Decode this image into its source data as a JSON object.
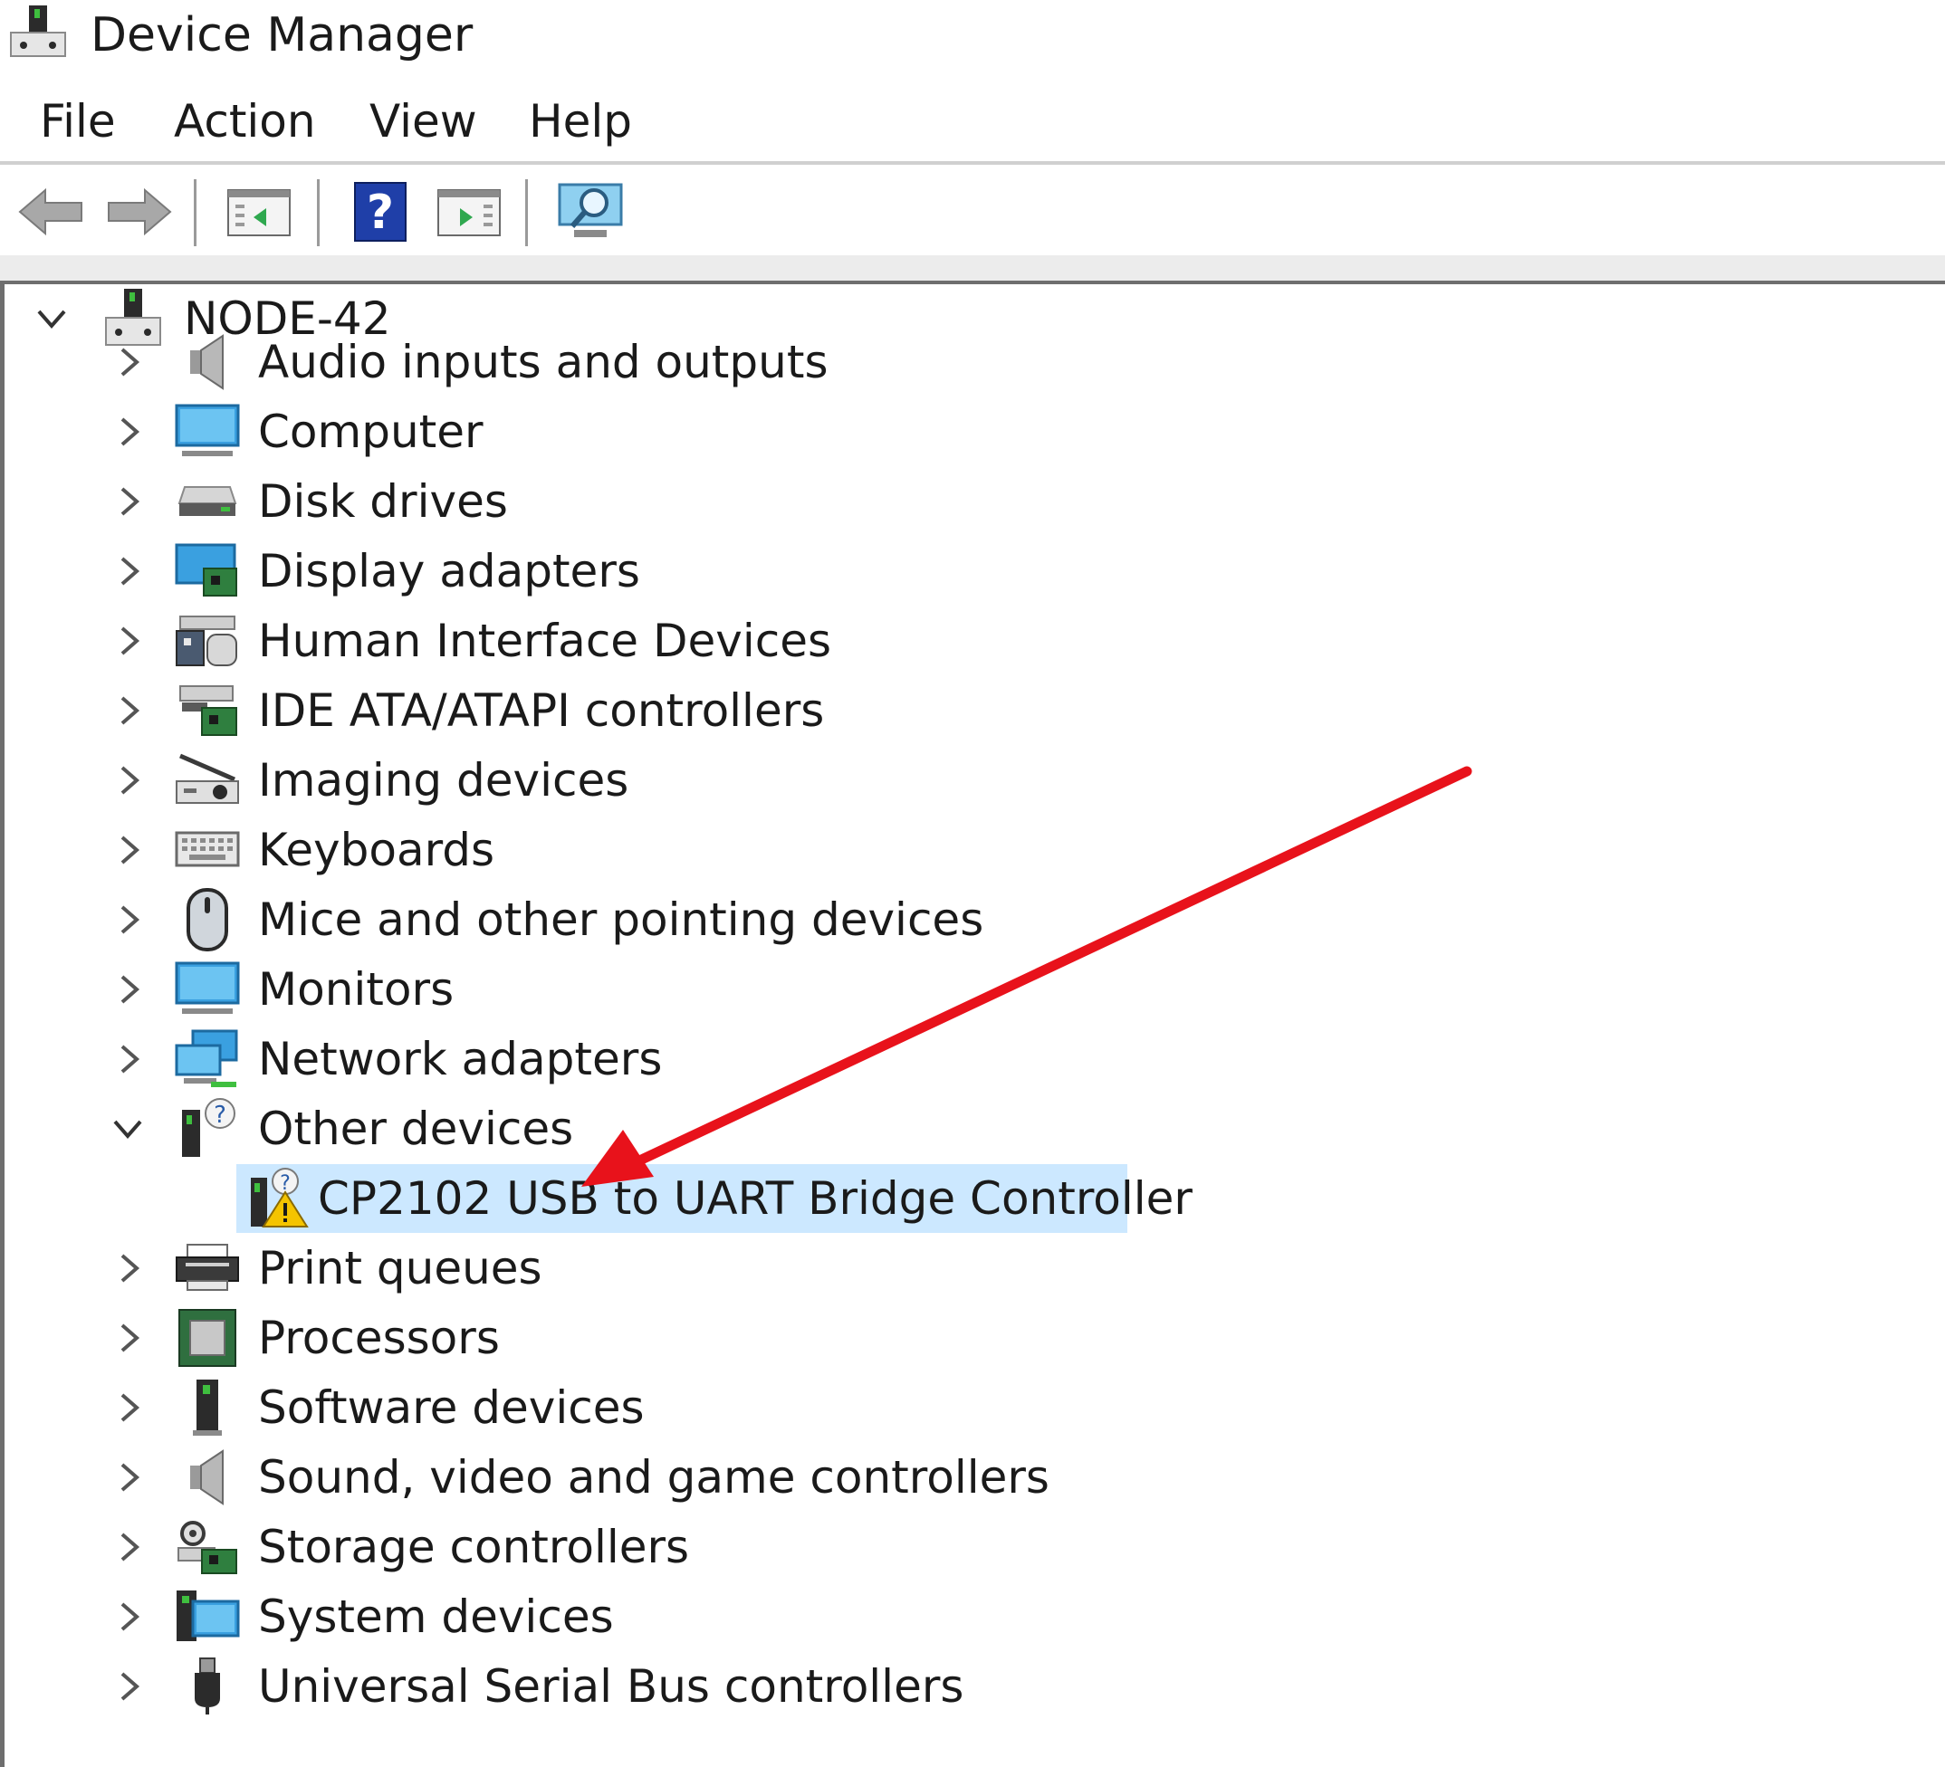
{
  "window": {
    "title": "Device Manager",
    "title_icon": "device-manager-icon"
  },
  "menu": {
    "file": "File",
    "action": "Action",
    "view": "View",
    "help": "Help"
  },
  "toolbar": {
    "back_icon": "back-arrow-icon",
    "forward_icon": "forward-arrow-icon",
    "show_hide_icon": "show-hide-console-tree-icon",
    "help_icon": "help-icon",
    "properties_icon": "properties-icon",
    "scan_icon": "scan-hardware-icon"
  },
  "tree": {
    "root": {
      "label": "NODE-42",
      "expanded": true,
      "icon": "computer-node-icon"
    },
    "categories": [
      {
        "label": "Audio inputs and outputs",
        "icon": "speaker-icon",
        "expanded": false
      },
      {
        "label": "Computer",
        "icon": "monitor-icon",
        "expanded": false
      },
      {
        "label": "Disk drives",
        "icon": "disk-drive-icon",
        "expanded": false
      },
      {
        "label": "Display adapters",
        "icon": "display-adapter-icon",
        "expanded": false
      },
      {
        "label": "Human Interface Devices",
        "icon": "hid-icon",
        "expanded": false
      },
      {
        "label": "IDE ATA/ATAPI controllers",
        "icon": "ide-controller-icon",
        "expanded": false
      },
      {
        "label": "Imaging devices",
        "icon": "scanner-icon",
        "expanded": false
      },
      {
        "label": "Keyboards",
        "icon": "keyboard-icon",
        "expanded": false
      },
      {
        "label": "Mice and other pointing devices",
        "icon": "mouse-icon",
        "expanded": false
      },
      {
        "label": "Monitors",
        "icon": "monitor-icon",
        "expanded": false
      },
      {
        "label": "Network adapters",
        "icon": "network-adapter-icon",
        "expanded": false
      },
      {
        "label": "Other devices",
        "icon": "unknown-device-icon",
        "expanded": true
      },
      {
        "label": "Print queues",
        "icon": "printer-icon",
        "expanded": false
      },
      {
        "label": "Processors",
        "icon": "processor-icon",
        "expanded": false
      },
      {
        "label": "Software devices",
        "icon": "software-device-icon",
        "expanded": false
      },
      {
        "label": "Sound, video and game controllers",
        "icon": "speaker-icon",
        "expanded": false
      },
      {
        "label": "Storage controllers",
        "icon": "storage-controller-icon",
        "expanded": false
      },
      {
        "label": "System devices",
        "icon": "system-device-icon",
        "expanded": false
      },
      {
        "label": "Universal Serial Bus controllers",
        "icon": "usb-icon",
        "expanded": false
      }
    ],
    "other_devices_children": [
      {
        "label": "CP2102 USB to UART Bridge Controller",
        "icon": "warning-device-icon",
        "selected": true,
        "status": "warning"
      }
    ]
  },
  "annotation": {
    "type": "arrow",
    "color": "#e8121b",
    "points_to": "CP2102 USB to UART Bridge Controller"
  },
  "colors": {
    "selection": "#cce8ff",
    "arrow": "#e8121b",
    "warning": "#f5c400"
  }
}
